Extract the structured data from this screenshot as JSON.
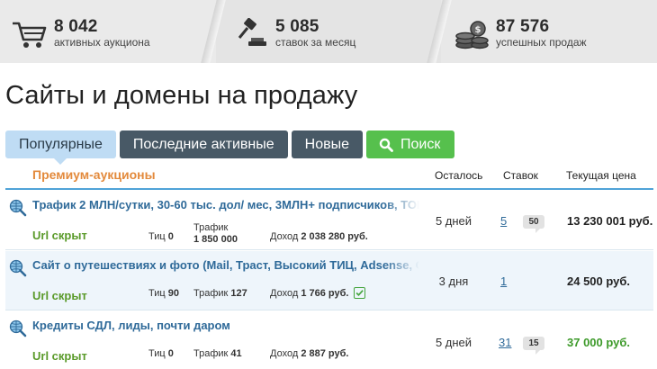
{
  "stats": [
    {
      "icon": "cart-icon",
      "value": "8 042",
      "label": "активных аукциона"
    },
    {
      "icon": "gavel-icon",
      "value": "5 085",
      "label": "ставок за месяц"
    },
    {
      "icon": "coins-icon",
      "value": "87 576",
      "label": "успешных продаж"
    }
  ],
  "title": "Сайты и домены на продажу",
  "tabs": {
    "popular": "Популярные",
    "recent": "Последние активные",
    "new": "Новые",
    "search": "Поиск"
  },
  "table": {
    "section_label": "Премиум-аукционы",
    "col_left": "Осталось",
    "col_bids": "Ставок",
    "col_price": "Текущая цена"
  },
  "rows": [
    {
      "title": "Трафик 2 МЛН/сутки, 30-60 тыс. дол/ мес, 3МЛН+ подписчиков, ТОП",
      "url": "Url скрыт",
      "tic_label": "Тиц",
      "tic": "0",
      "traffic_label": "Трафик",
      "traffic": "1 850 000",
      "income_label": "Доход",
      "income": "2 038 280 руб.",
      "verified": false,
      "left": "5 дней",
      "bids": "5",
      "comments": "50",
      "price": "13 230 001 руб."
    },
    {
      "title": "Сайт о путешествиях и фото (Mail, Траст, Высокий ТИЦ, Adsense, С",
      "url": "Url скрыт",
      "tic_label": "Тиц",
      "tic": "90",
      "traffic_label": "Трафик",
      "traffic": "127",
      "income_label": "Доход",
      "income": "1 766 руб.",
      "verified": true,
      "left": "3 дня",
      "bids": "1",
      "comments": "",
      "price": "24 500 руб."
    },
    {
      "title": "Кредиты СДЛ, лиды, почти даром",
      "url": "Url скрыт",
      "tic_label": "Тиц",
      "tic": "0",
      "traffic_label": "Трафик",
      "traffic": "41",
      "income_label": "Доход",
      "income": "2 887 руб.",
      "verified": false,
      "left": "5 дней",
      "bids": "31",
      "comments": "15",
      "price": "37 000 руб."
    }
  ],
  "colors": {
    "accent_blue": "#4fa3d8",
    "tab_active": "#bfdcf4",
    "tab_dark": "#485966",
    "search_green": "#56c04d",
    "premium_orange": "#e38a3c",
    "link_blue": "#2f6a99",
    "url_green": "#5a9a2a"
  }
}
